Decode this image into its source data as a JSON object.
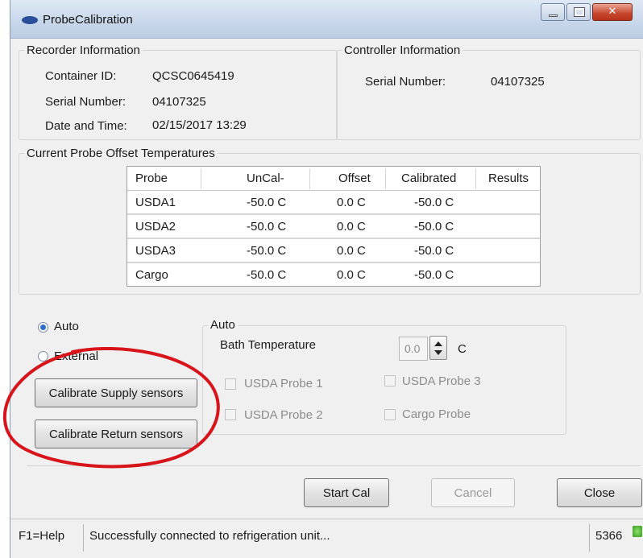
{
  "window": {
    "title": "ProbeCalibration"
  },
  "recorder": {
    "legend": "Recorder Information",
    "container_id_label": "Container ID:",
    "container_id": "QCSC0645419",
    "serial_label": "Serial Number:",
    "serial": "04107325",
    "datetime_label": "Date and Time:",
    "datetime": "02/15/2017 13:29"
  },
  "controller": {
    "legend": "Controller Information",
    "serial_label": "Serial Number:",
    "serial": "04107325"
  },
  "offsets": {
    "legend": "Current Probe Offset Temperatures",
    "columns": [
      "Probe",
      "UnCal-",
      "Offset",
      "Calibrated",
      "Results"
    ],
    "rows": [
      {
        "probe": "USDA1",
        "uncal": "-50.0 C",
        "offset": "0.0 C",
        "calibrated": "-50.0 C",
        "results": ""
      },
      {
        "probe": "USDA2",
        "uncal": "-50.0 C",
        "offset": "0.0 C",
        "calibrated": "-50.0 C",
        "results": ""
      },
      {
        "probe": "USDA3",
        "uncal": "-50.0 C",
        "offset": "0.0 C",
        "calibrated": "-50.0 C",
        "results": ""
      },
      {
        "probe": "Cargo",
        "uncal": "-50.0 C",
        "offset": "0.0 C",
        "calibrated": "-50.0 C",
        "results": ""
      }
    ]
  },
  "mode": {
    "auto_label": "Auto",
    "external_label": "External",
    "selected": "Auto",
    "calibrate_supply_label": "Calibrate Supply sensors",
    "calibrate_return_label": "Calibrate Return sensors"
  },
  "auto_group": {
    "legend": "Auto",
    "bath_label": "Bath Temperature",
    "bath_value": "0.0",
    "bath_unit": "C",
    "probes": [
      "USDA Probe 1",
      "USDA Probe 2",
      "USDA Probe 3",
      "Cargo Probe"
    ]
  },
  "actions": {
    "start": "Start Cal",
    "cancel": "Cancel",
    "close": "Close"
  },
  "status": {
    "help": "F1=Help",
    "message": "Successfully connected to refrigeration unit...",
    "code": "5366"
  },
  "colors": {
    "annotation_circle": "#d8141b",
    "status_ok": "#3aa620"
  }
}
